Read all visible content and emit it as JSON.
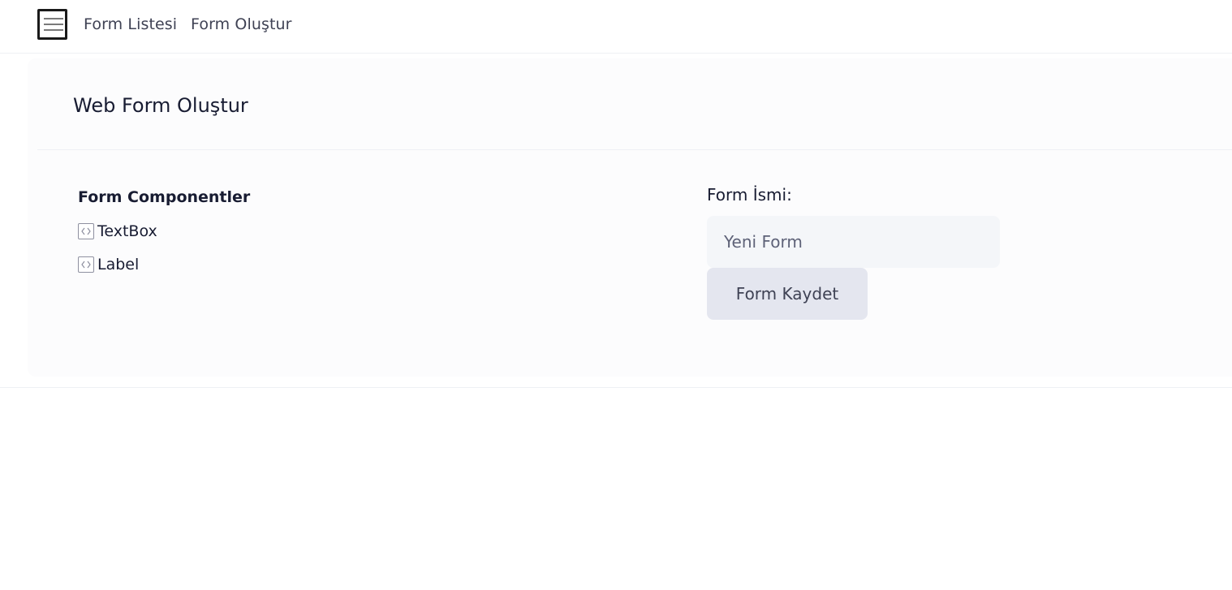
{
  "nav": {
    "menu_icon": "hamburger-menu-icon",
    "links": [
      {
        "label": "Form Listesi"
      },
      {
        "label": "Form Oluştur"
      }
    ]
  },
  "card": {
    "title": "Web Form Oluştur"
  },
  "components": {
    "title": "Form Componentler",
    "icon": "code-icon",
    "items": [
      {
        "label": "TextBox"
      },
      {
        "label": "Label"
      }
    ]
  },
  "form": {
    "name_label": "Form İsmi:",
    "name_value": "Yeni Form",
    "save_label": "Form Kaydet"
  }
}
